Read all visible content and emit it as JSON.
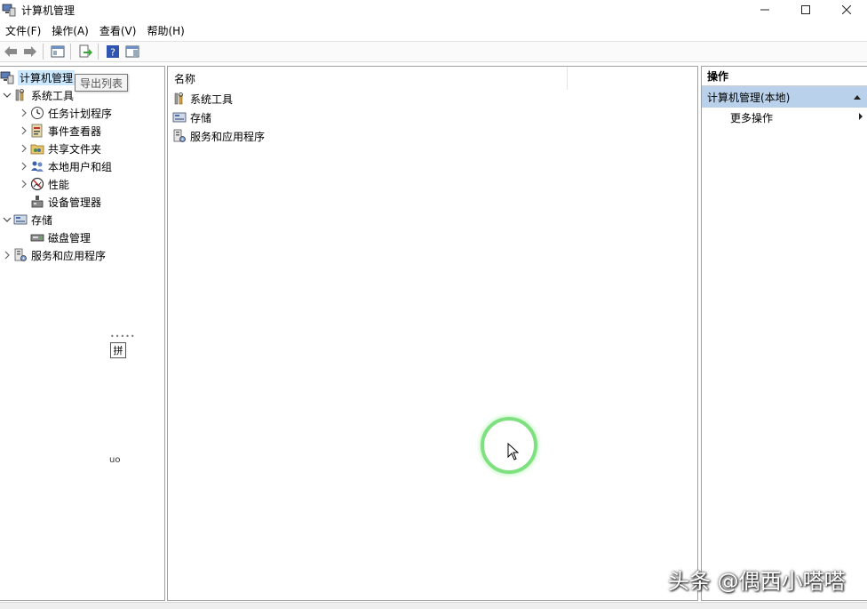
{
  "window": {
    "title": "计算机管理"
  },
  "menu": [
    "文件(F)",
    "操作(A)",
    "查看(V)",
    "帮助(H)"
  ],
  "tooltip": "导出列表",
  "tree": {
    "root": "计算机管理",
    "system_tools": "系统工具",
    "task_scheduler": "任务计划程序",
    "event_viewer": "事件查看器",
    "shared_folders": "共享文件夹",
    "local_users": "本地用户和组",
    "performance": "性能",
    "device_manager": "设备管理器",
    "storage": "存储",
    "disk_management": "磁盘管理",
    "services_apps": "服务和应用程序"
  },
  "list": {
    "column_name": "名称",
    "rows": [
      "系统工具",
      "存储",
      "服务和应用程序"
    ]
  },
  "actions": {
    "header": "操作",
    "section": "计算机管理(本地)",
    "more": "更多操作"
  },
  "ime": {
    "pin": "拼",
    "small": "uo"
  },
  "watermark": "头条 @偶西小嗒嗒"
}
